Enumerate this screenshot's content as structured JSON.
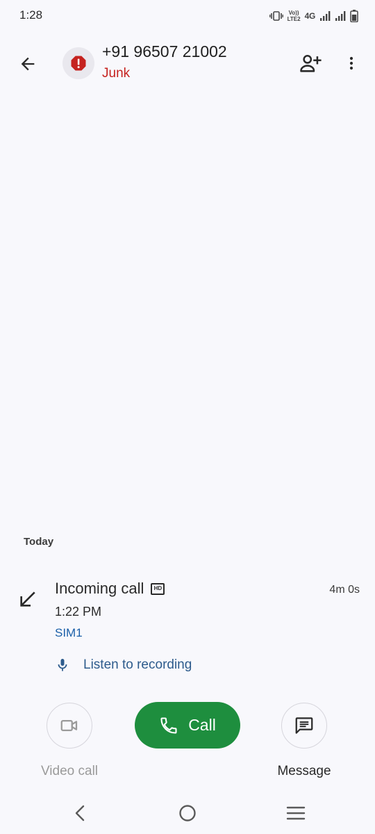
{
  "status_bar": {
    "time": "1:28",
    "network": "4G",
    "volte_line1": "Vo))",
    "volte_line2": "LTE2",
    "icons": [
      "vibrate-icon",
      "volte-icon",
      "signal-icon",
      "signal-icon",
      "battery-icon"
    ]
  },
  "header": {
    "contact_number": "+91 96507 21002",
    "contact_label": "Junk",
    "icons": {
      "back": "arrow-back-icon",
      "avatar": "spam-alert-icon",
      "add_contact": "person-add-icon",
      "more": "more-vert-icon"
    }
  },
  "history": {
    "section_title": "Today",
    "entries": [
      {
        "type": "Incoming call",
        "badge": "HD",
        "time": "1:22 PM",
        "sim": "SIM1",
        "duration": "4m 0s",
        "recording_label": "Listen to recording"
      }
    ]
  },
  "actions": {
    "video_call": "Video call",
    "call": "Call",
    "message": "Message"
  },
  "colors": {
    "background": "#f8f8fc",
    "junk_red": "#c5221f",
    "call_green": "#1e8e3e",
    "sim_blue": "#1a5fa8",
    "link_blue": "#2d5b8c"
  }
}
